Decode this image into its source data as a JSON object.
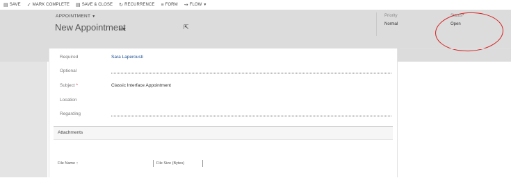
{
  "commands": [
    {
      "icon": "save-icon",
      "glyph": "▤",
      "label": "SAVE"
    },
    {
      "icon": "checkmark-icon",
      "glyph": "✓",
      "label": "MARK COMPLETE"
    },
    {
      "icon": "save-close-icon",
      "glyph": "▤",
      "label": "SAVE & CLOSE"
    },
    {
      "icon": "recurrence-icon",
      "glyph": "↻",
      "label": "RECURRENCE"
    },
    {
      "icon": "form-icon",
      "glyph": "≡",
      "label": "FORM"
    },
    {
      "icon": "flow-icon",
      "glyph": "⇝",
      "label": "FLOW"
    }
  ],
  "header": {
    "entity": "APPOINTMENT",
    "title": "New Appointment",
    "priority_label": "Priority",
    "priority_value": "Normal",
    "status_label": "Status",
    "status_required": "*",
    "status_value": "Open"
  },
  "form": {
    "required_label": "Required",
    "required_value": "Sara Laperousti",
    "optional_label": "Optional",
    "subject_label": "Subject",
    "subject_required": "*",
    "subject_value": "Classic Interface Appointment",
    "location_label": "Location",
    "regarding_label": "Regarding"
  },
  "attachments": {
    "title": "Attachments",
    "col_file_name": "File Name",
    "col_sort_glyph": "↑",
    "col_file_size": "File Size (Bytes)"
  },
  "colors": {
    "header_bg": "#dcdcdc",
    "annotation_circle": "#d62020",
    "link": "#1b4d91"
  }
}
